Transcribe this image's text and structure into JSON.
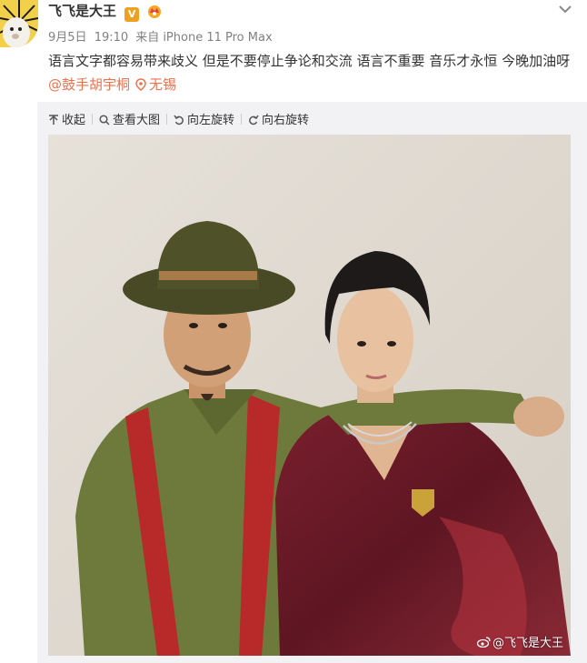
{
  "author": {
    "name": "飞飞是大王",
    "verified_mark": "V"
  },
  "meta": {
    "date": "9月5日",
    "time": "19:10",
    "source_prefix": "来自",
    "device": "iPhone 11 Pro Max"
  },
  "post": {
    "text": "语言文字都容易带来歧义 但是不要停止争论和交流 语言不重要 音乐才永恒 今晚加油呀",
    "mention": "@鼓手胡宇桐",
    "location": "无锡"
  },
  "toolbar": {
    "collapse": "收起",
    "view_large": "查看大图",
    "rotate_left": "向左旋转",
    "rotate_right": "向右旋转"
  },
  "photo": {
    "watermark": "@飞飞是大王"
  },
  "colors": {
    "link": "#eb7350",
    "panel": "#f2f2f5",
    "verified": "#f0a020"
  }
}
